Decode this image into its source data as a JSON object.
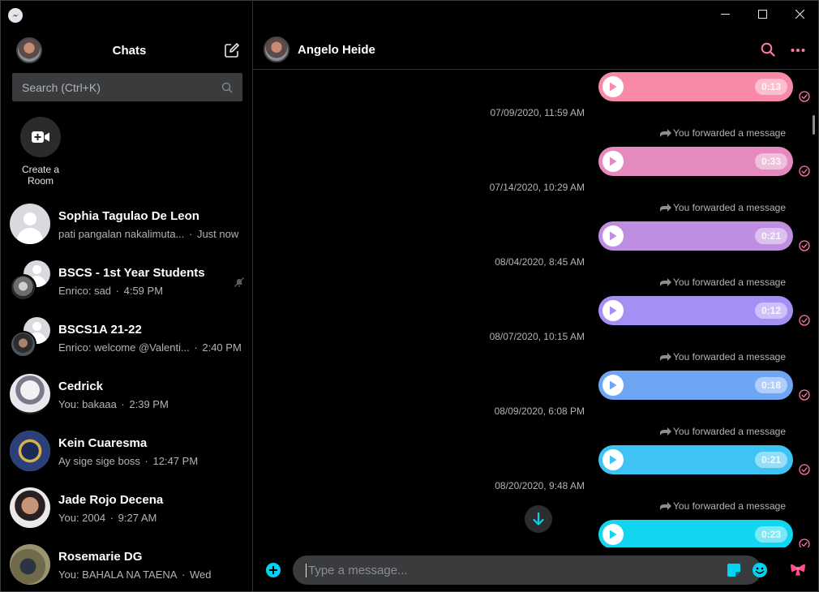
{
  "window": {
    "controls": [
      "minimize",
      "maximize",
      "close"
    ]
  },
  "sidebar": {
    "title": "Chats",
    "search_placeholder": "Search (Ctrl+K)",
    "create_room_label": "Create a Room",
    "chats": [
      {
        "name": "Sophia Tagulao De Leon",
        "preview": "pati pangalan nakalimuta...",
        "time": "Just now",
        "avatar": "default"
      },
      {
        "name": "BSCS - 1st Year Students",
        "preview": "Enrico: sad",
        "time": "4:59 PM",
        "avatar": "group",
        "muted": true
      },
      {
        "name": "BSCS1A 21-22",
        "preview": "Enrico: welcome @Valenti...",
        "time": "2:40 PM",
        "avatar": "group"
      },
      {
        "name": "Cedrick",
        "preview": "You: bakaaa",
        "time": "2:39 PM",
        "avatar": "photo"
      },
      {
        "name": "Kein Cuaresma",
        "preview": "Ay sige sige boss",
        "time": "12:47 PM",
        "avatar": "photo"
      },
      {
        "name": "Jade Rojo Decena",
        "preview": "You: 2004",
        "time": "9:27 AM",
        "avatar": "photo"
      },
      {
        "name": "Rosemarie DG",
        "preview": "You: BAHALA NA TAENA",
        "time": "Wed",
        "avatar": "photo"
      }
    ]
  },
  "conversation": {
    "contact_name": "Angelo Heide",
    "forward_label": "You forwarded a message",
    "messages": [
      {
        "timestamp": "",
        "duration": "0:13",
        "color": "#f88aa8",
        "progress": 0
      },
      {
        "timestamp": "07/09/2020, 11:59 AM",
        "duration": "0:33",
        "color": "#e48abf",
        "progress": 0
      },
      {
        "timestamp": "07/14/2020, 10:29 AM",
        "duration": "0:21",
        "color": "#c08ee0",
        "progress": 0
      },
      {
        "timestamp": "08/04/2020, 8:45 AM",
        "duration": "0:12",
        "color": "#a68ff4",
        "progress": 0
      },
      {
        "timestamp": "08/07/2020, 10:15 AM",
        "duration": "0:18",
        "color": "#6fa6f4",
        "progress": 0
      },
      {
        "timestamp": "08/09/2020, 6:08 PM",
        "duration": "0:21",
        "color": "#3fc3f2",
        "progress": 0
      },
      {
        "timestamp": "08/20/2020, 9:48 AM",
        "duration": "0:23",
        "color": "#12d6ef",
        "progress": 0
      }
    ],
    "composer_placeholder": "Type a message...",
    "accent_color": "#ff7aa2",
    "theme_accent_start": "#f88aa8",
    "theme_accent_end": "#00e1f5"
  }
}
